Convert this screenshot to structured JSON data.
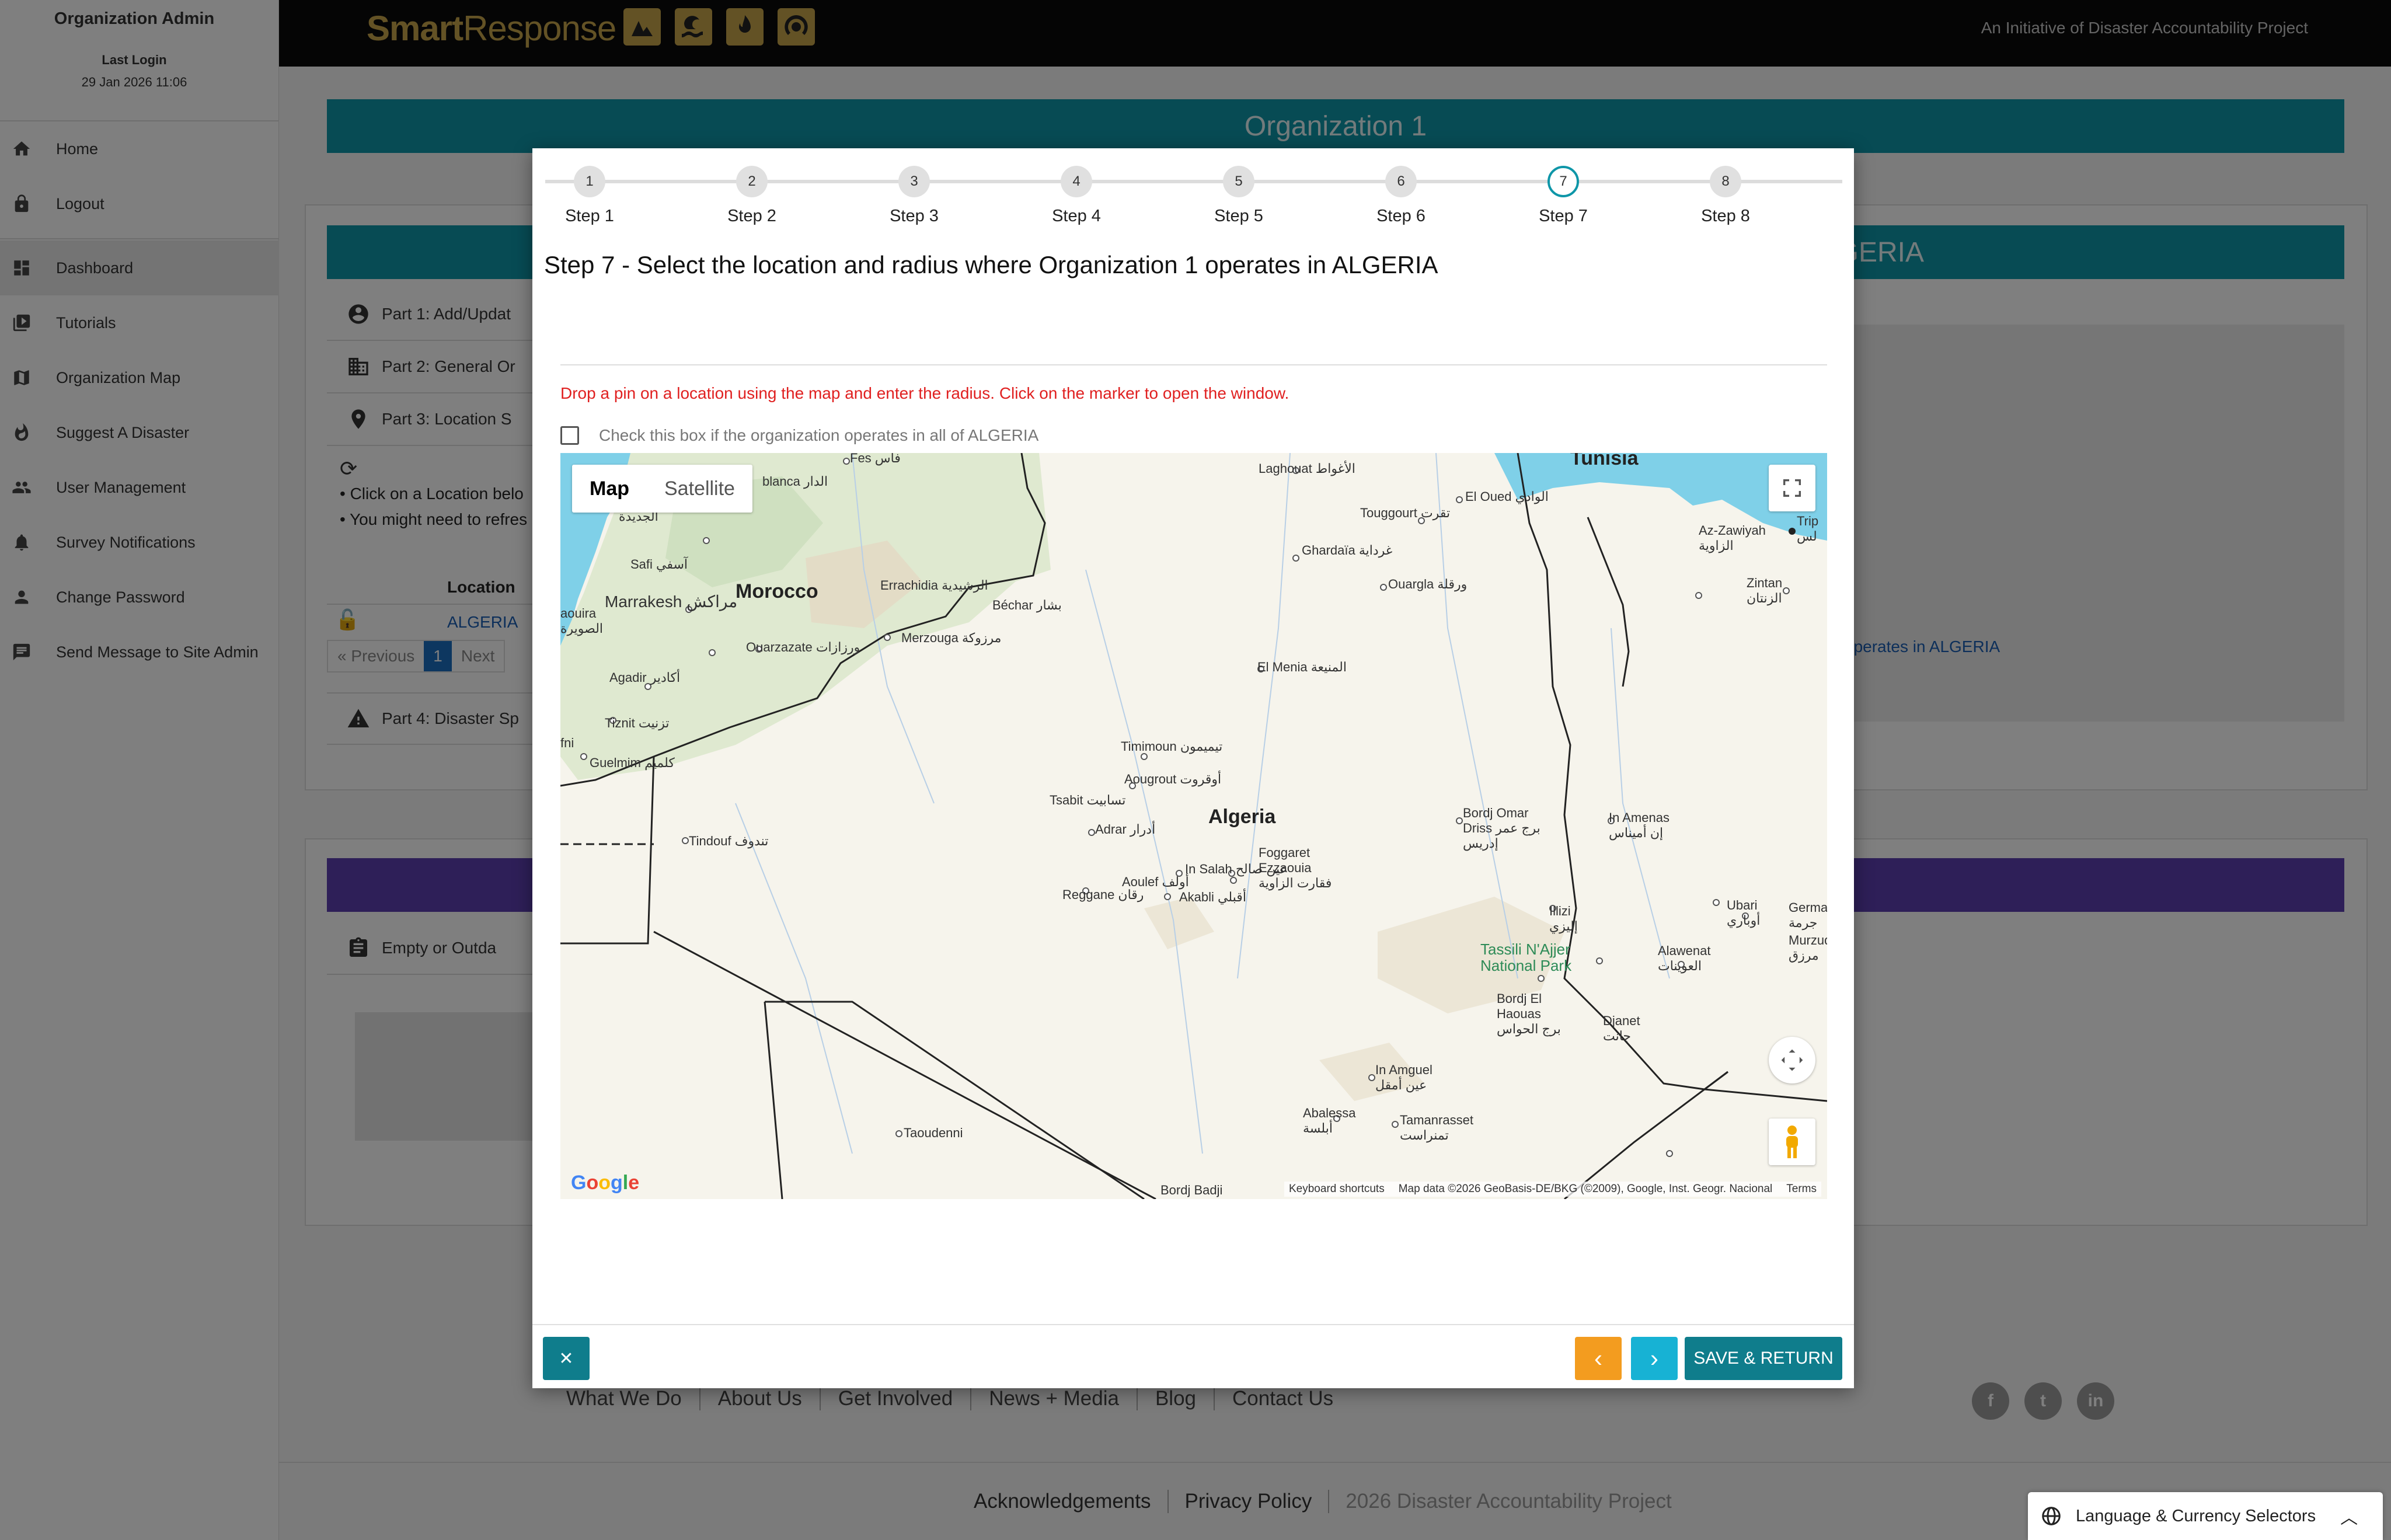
{
  "sidebar": {
    "user_name": "Organization Admin",
    "last_login_label": "Last Login",
    "last_login_date": "29 Jan 2026 11:06",
    "items": [
      {
        "label": "Home",
        "icon": "home-icon"
      },
      {
        "label": "Logout",
        "icon": "lock-icon"
      },
      {
        "label": "Dashboard",
        "icon": "dashboard-icon"
      },
      {
        "label": "Tutorials",
        "icon": "video-library-icon"
      },
      {
        "label": "Organization Map",
        "icon": "map-icon"
      },
      {
        "label": "Suggest A Disaster",
        "icon": "fire-icon"
      },
      {
        "label": "User Management",
        "icon": "people-icon"
      },
      {
        "label": "Survey Notifications",
        "icon": "bell-icon"
      },
      {
        "label": "Change Password",
        "icon": "person-icon"
      },
      {
        "label": "Send Message to Site Admin",
        "icon": "message-icon"
      }
    ]
  },
  "header": {
    "logo_smart": "Smart",
    "logo_response": "Response",
    "initiative": "An Initiative of Disaster Accountability Project"
  },
  "background": {
    "org_banner": "Organization 1",
    "survey_banner": "vey ALGERIA",
    "parts": [
      {
        "label": "Part 1: Add/Updat",
        "icon": "account-circle-icon"
      },
      {
        "label": "Part 2: General Or",
        "icon": "building-icon"
      },
      {
        "label": "Part 3: Location S",
        "icon": "location-pin-icon"
      }
    ],
    "bullet1": "• Click on a Location belo",
    "bullet2": "• You might need to refres",
    "location_header": "Location",
    "location_value": "ALGERIA",
    "pager": {
      "previous": "« Previous",
      "page": "1",
      "next": "Next"
    },
    "part4": "Part 4: Disaster Sp",
    "right_link": "operates in ALGERIA",
    "empty_row": "Empty or Outda"
  },
  "footer": {
    "links": [
      "What We Do",
      "About Us",
      "Get Involved",
      "News + Media",
      "Blog",
      "Contact Us"
    ],
    "legal": [
      "Acknowledgements",
      "Privacy Policy",
      "2026 Disaster Accountability Project"
    ],
    "lang_selector": "Language & Currency Selectors"
  },
  "modal": {
    "steps": [
      {
        "num": "1",
        "label": "Step 1"
      },
      {
        "num": "2",
        "label": "Step 2"
      },
      {
        "num": "3",
        "label": "Step 3"
      },
      {
        "num": "4",
        "label": "Step 4"
      },
      {
        "num": "5",
        "label": "Step 5"
      },
      {
        "num": "6",
        "label": "Step 6"
      },
      {
        "num": "7",
        "label": "Step 7"
      },
      {
        "num": "8",
        "label": "Step 8"
      }
    ],
    "current_step": "7",
    "title": "Step 7 - Select the location and radius where Organization 1 operates in ALGERIA",
    "instruction": "Drop a pin on a location using the map and enter the radius. Click on the marker to open the window.",
    "checkbox_label": "Check this box if the organization operates in all of ALGERIA",
    "checkbox_checked": false,
    "map": {
      "type_map": "Map",
      "type_satellite": "Satellite",
      "selected_type": "Map",
      "labels": {
        "tunisia": "Tunisia",
        "morocco": "Morocco",
        "algeria": "Algeria",
        "tassili": "Tassili N'Ajjer National Park",
        "fes": "Fes فاس",
        "blanca": "blanca الدار",
        "marrakesh": "Marrakesh مراكش",
        "safi": "Safi آسفي",
        "errachidia": "Errachidia الرشيدية",
        "ouarzazate": "Ouarzazate ورزازات",
        "merzouga": "Merzouga مرزوكة",
        "bechar": "Béchar بشار",
        "agadir": "Agadir أكادير",
        "tiznit": "Tiznit تزنيت",
        "guelmim": "Guelmim كلميم",
        "tindouf": "Tindouf تندوف",
        "laghouat": "Laghouat الأغواط",
        "touggourt": "Touggourt تقرت",
        "eloued": "El Oued الوادي",
        "ghardaia": "Ghardaïa غرداية",
        "ouargla": "Ouargla ورقلة",
        "elmenia": "El Menia المنيعة",
        "timimoun": "Timimoun تيميمون",
        "aougrout": "Aougrout أوقروت",
        "tsabit": "Tsabit تسابيت",
        "adrar": "Adrar أدرار",
        "aoulef": "Aoulef أولف",
        "reggane": "Reggane رقان",
        "insalah": "In Salah عين صالح",
        "akabli": "Akabli أقبلي",
        "foggaret": "Foggaret Ezzaouia فقارت الزاوية",
        "bordjomar": "Bordj Omar Driss برج عمر إدريس",
        "inamenas": "In Amenas إن أميناس",
        "illizi": "Illizi إليزي",
        "alawenat": "Alawenat العوينات",
        "ubari": "Ubari أوباري",
        "germa": "Germa جرمة",
        "murzuq": "Murzuq مرزق",
        "bordjelhaouas": "Bordj El Haouas برج الحواس",
        "djanet": "Djanet جانت",
        "inamguel": "In Amguel عين أمقل",
        "abalessa": "Abalessa أبلسة",
        "tamanrasset": "Tamanrasset تمنراست",
        "taoudenni": "Taoudenni",
        "bordjbadji": "Bordj Badji",
        "azzawiyah": "Az-Zawiyah الزاوية",
        "zintan": "Zintan الزنتان",
        "tripoli": "Trip لس",
        "aouira": "aouira الصويرة",
        "jadida": "الجديدة",
        "fni": "fni"
      },
      "attribution": {
        "google": "Google",
        "shortcuts": "Keyboard shortcuts",
        "mapdata": "Map data ©2026 GeoBasis-DE/BKG (©2009), Google, Inst. Geogr. Nacional",
        "terms": "Terms"
      }
    },
    "buttons": {
      "close": "✕",
      "prev": "‹",
      "next": "›",
      "save": "SAVE & RETURN"
    },
    "colors": {
      "teal": "#0e96a8",
      "orange": "#f39c1f",
      "cyan": "#17b2d4",
      "dark_teal": "#0f7d8c",
      "warning_red": "#e02020"
    }
  }
}
